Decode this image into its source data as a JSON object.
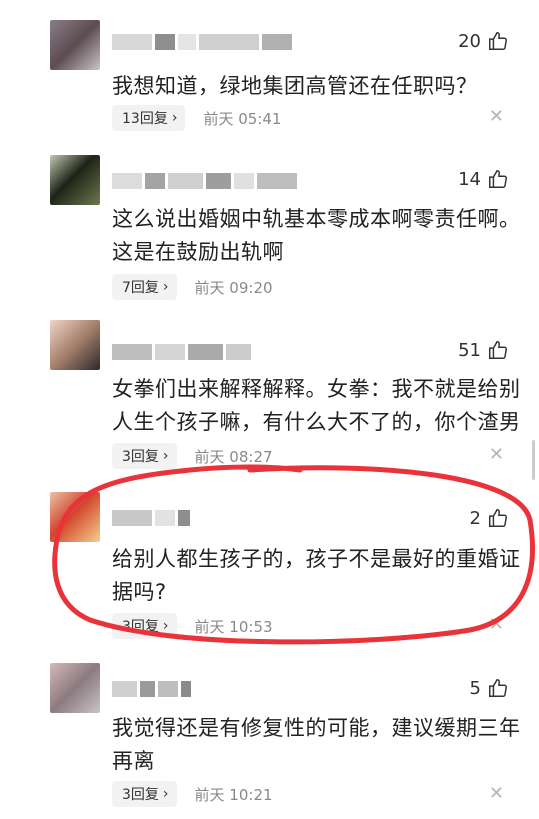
{
  "comments": [
    {
      "likes": "20",
      "text": "我想知道，绿地集团高管还在任职吗？",
      "reply": "13回复",
      "time": "前天 05:41"
    },
    {
      "likes": "14",
      "text": "这么说出婚姻中轨基本零成本啊零责任啊。这是在鼓励出轨啊",
      "reply": "7回复",
      "time": "前天 09:20"
    },
    {
      "likes": "51",
      "text": "女拳们出来解释解释。女拳：我不就是给别人生个孩子嘛，有什么大不了的，你个渣男",
      "reply": "3回复",
      "time": "前天 08:27"
    },
    {
      "likes": "2",
      "text": "给别人都生孩子的，孩子不是最好的重婚证据吗?",
      "reply": "3回复",
      "time": "前天 10:53"
    },
    {
      "likes": "5",
      "text": "我觉得还是有修复性的可能，建议缓期三年再离",
      "reply": "3回复",
      "time": "前天 10:21"
    }
  ],
  "icons": {
    "like": "thumbs-up-icon",
    "reply_arrow": "chevron-right-icon",
    "close": "close-icon"
  },
  "colors": {
    "annotation": "#e8333a",
    "text": "#222222",
    "time": "#8a8a8a"
  }
}
